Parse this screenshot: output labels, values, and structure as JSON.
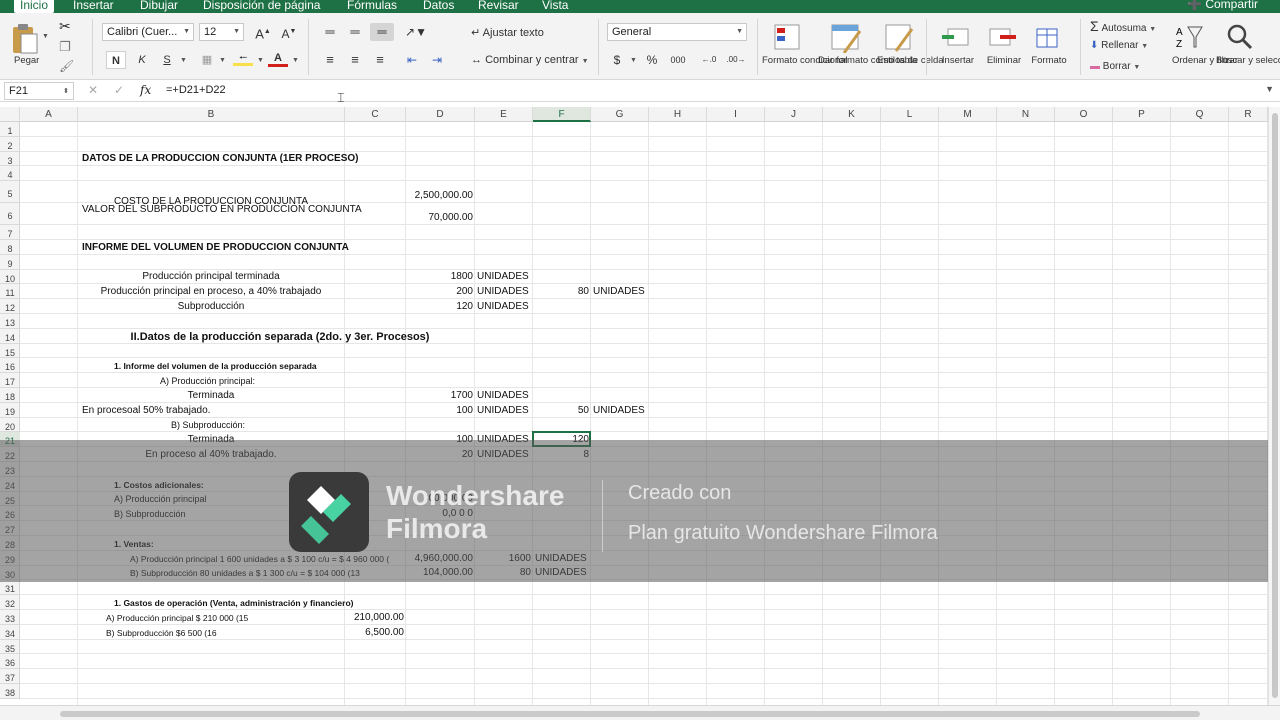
{
  "tabs": [
    "Inicio",
    "Insertar",
    "Dibujar",
    "Disposición de página",
    "Fórmulas",
    "Datos",
    "Revisar",
    "Vista"
  ],
  "share_label": "Compartir",
  "ribbon": {
    "paste_label": "Pegar",
    "font_name": "Calibri (Cuer...",
    "font_size": "12",
    "bold": "N",
    "italic": "K",
    "underline": "S",
    "wrap_text": "Ajustar texto",
    "merge_center": "Combinar y centrar",
    "number_format": "General",
    "currency": "$",
    "percent": "%",
    "thousands": "000",
    "cond_format": "Formato condicional",
    "table_format": "Dar formato como tabla",
    "cell_styles": "Estilos de celda",
    "insert": "Insertar",
    "delete": "Eliminar",
    "format": "Formato",
    "autosum": "Autosuma",
    "fill": "Rellenar",
    "clear": "Borrar",
    "sort_filter": "Ordenar y filtrar",
    "find_select": "Buscar y seleccionar",
    "fill_color": "#f7e04a",
    "font_color": "#d1201b"
  },
  "formula_bar": {
    "name_box": "F21",
    "fx": "fx",
    "formula": "=+D21+D22"
  },
  "columns": [
    "A",
    "B",
    "C",
    "D",
    "E",
    "F",
    "G",
    "H",
    "I",
    "J",
    "K",
    "L",
    "M",
    "N",
    "O",
    "P",
    "Q",
    "R"
  ],
  "rows": [
    "1",
    "2",
    "3",
    "4",
    "5",
    "6",
    "7",
    "8",
    "9",
    "10",
    "11",
    "12",
    "13",
    "14",
    "15",
    "16",
    "17",
    "18",
    "19",
    "20",
    "21",
    "22",
    "23",
    "24",
    "25",
    "26",
    "27",
    "28",
    "29",
    "30",
    "31",
    "32",
    "33",
    "34",
    "35",
    "36",
    "37",
    "38"
  ],
  "cells": {
    "b3": "DATOS DE LA PRODUCCION CONJUNTA (1ER PROCESO)",
    "b5": "COSTO DE LA PRODUCCION CONJUNTA",
    "d5": "2,500,000.00",
    "b6": "VALOR DEL SUBPRODUCTO EN PRODUCCION CONJUNTA",
    "d6": "70,000.00",
    "b8": "INFORME DEL VOLUMEN DE PRODUCCION CONJUNTA",
    "b10": "Producción principal terminada",
    "d10": "1800",
    "e10": "UNIDADES",
    "b11": "Producción principal en proceso, a 40% trabajado",
    "d11": "200",
    "e11": "UNIDADES",
    "f11": "80",
    "g11": "UNIDADES",
    "b12": "Subproducción",
    "d12": "120",
    "e12": "UNIDADES",
    "b14": "II.Datos de la producción separada (2do. y 3er. Procesos)",
    "b16": "1.    Informe del volumen de la producción separada",
    "b17": "A)    Producción principal:",
    "b18": "Terminada",
    "d18": "1700",
    "e18": "UNIDADES",
    "a19": "En procesoal 50% trabajado.",
    "d19": "100",
    "e19": "UNIDADES",
    "f19": "50",
    "g19": "UNIDADES",
    "b20": "B)    Subproducción:",
    "b21": "Terminada",
    "d21": "100",
    "e21": "UNIDADES",
    "f21": "120",
    "b22": "En proceso al 40% trabajado.",
    "d22": "20",
    "e22": "UNIDADES",
    "f22": "8",
    "b24": "1.    Costos adicionales:",
    "b25": "A)    Producción principal",
    "d25": "300,000.00",
    "b26": "B) Subproducción",
    "d26": "0,0 0 0",
    "b28": "1.    Ventas:",
    "b29": "A)    Producción principal 1 600 unidades a $ 3 100 c/u = $ 4 960 000 (",
    "d29": "4,960,000.00",
    "e29": "1600",
    "f29": "UNIDADES",
    "b30": "B)    Subproducción 80 unidades a $ 1 300 c/u = $ 104 000 (13",
    "d30": "104,000.00",
    "e30": "80",
    "f30": "UNIDADES",
    "b32": "1.    Gastos de operación (Venta, administración y financiero)",
    "b33": "A)    Producción principal $ 210 000 (15",
    "c33": "210,000.00",
    "b34": "B)    Subproducción $6 500 (16",
    "c34": "6,500.00"
  },
  "watermark": {
    "brand_line1": "Wondershare",
    "brand_line2": "Filmora",
    "text1": "Creado con",
    "text2": "Plan gratuito Wondershare Filmora"
  }
}
